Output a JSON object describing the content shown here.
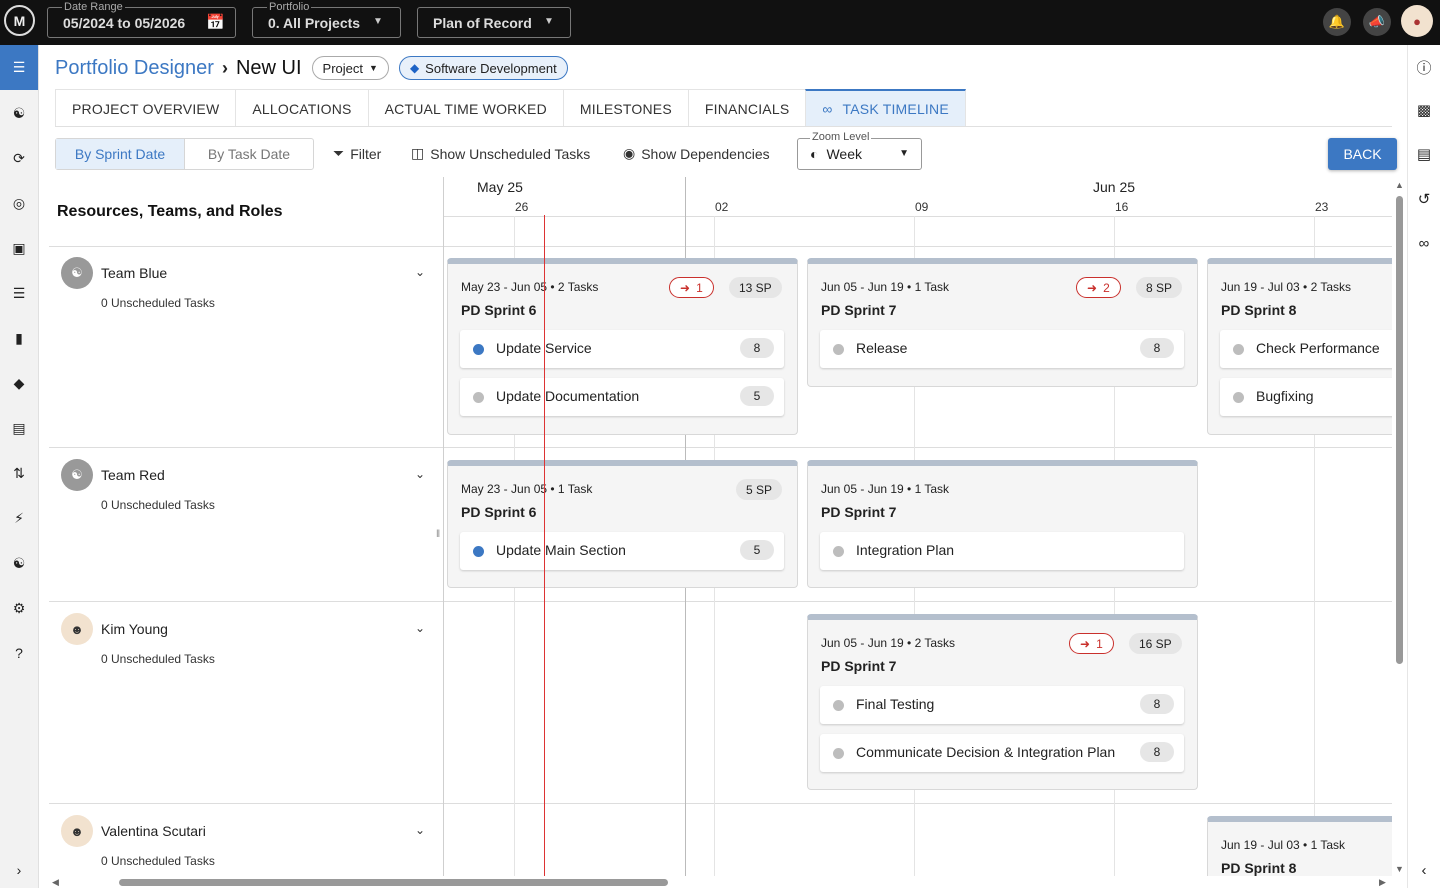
{
  "topbar": {
    "logo": "M",
    "date_range": {
      "label": "Date Range",
      "value": "05/2024 to 05/2026"
    },
    "portfolio": {
      "label": "Portfolio",
      "value": "0. All Projects"
    },
    "plan": {
      "value": "Plan of Record"
    }
  },
  "header": {
    "crumb_link": "Portfolio Designer",
    "crumb_current": "New UI",
    "project_pill": "Project",
    "tag_pill": "Software Development"
  },
  "tabs": [
    "PROJECT OVERVIEW",
    "ALLOCATIONS",
    "ACTUAL TIME WORKED",
    "MILESTONES",
    "FINANCIALS",
    "TASK TIMELINE"
  ],
  "toolbar": {
    "seg_sprint": "By Sprint Date",
    "seg_task": "By Task Date",
    "filter": "Filter",
    "unscheduled": "Show Unscheduled Tasks",
    "dependencies": "Show Dependencies",
    "zoom_label": "Zoom Level",
    "zoom_value": "Week",
    "back": "BACK"
  },
  "grid": {
    "resources_heading": "Resources, Teams, and Roles",
    "months": [
      {
        "label": "May 25"
      },
      {
        "label": "Jun 25"
      }
    ],
    "days": [
      "26",
      "02",
      "09",
      "16",
      "23"
    ]
  },
  "resources": [
    {
      "name": "Team Blue",
      "unscheduled": "0 Unscheduled Tasks",
      "type": "team"
    },
    {
      "name": "Team Red",
      "unscheduled": "0 Unscheduled Tasks",
      "type": "team"
    },
    {
      "name": "Kim Young",
      "unscheduled": "0 Unscheduled Tasks",
      "type": "person"
    },
    {
      "name": "Valentina Scutari",
      "unscheduled": "0 Unscheduled Tasks",
      "type": "person"
    }
  ],
  "cards": [
    {
      "meta": "May 23 - Jun 05 • 2 Tasks",
      "title": "PD Sprint 6",
      "dep": "1",
      "sp": "13 SP",
      "tasks": [
        {
          "name": "Update Service",
          "pts": "8",
          "dot": "blue"
        },
        {
          "name": "Update Documentation",
          "pts": "5",
          "dot": "gray"
        }
      ]
    },
    {
      "meta": "Jun 05 - Jun 19 • 1 Task",
      "title": "PD Sprint 7",
      "dep": "2",
      "sp": "8 SP",
      "tasks": [
        {
          "name": "Release",
          "pts": "8",
          "dot": "gray"
        }
      ]
    },
    {
      "meta": "Jun 19 - Jul 03 • 2 Tasks",
      "title": "PD Sprint 8",
      "tasks": [
        {
          "name": "Check Performance",
          "dot": "gray"
        },
        {
          "name": "Bugfixing",
          "dot": "gray"
        }
      ]
    },
    {
      "meta": "May 23 - Jun 05 • 1 Task",
      "title": "PD Sprint 6",
      "sp": "5 SP",
      "tasks": [
        {
          "name": "Update Main Section",
          "pts": "5",
          "dot": "blue"
        }
      ]
    },
    {
      "meta": "Jun 05 - Jun 19 • 1 Task",
      "title": "PD Sprint 7",
      "tasks": [
        {
          "name": "Integration Plan",
          "dot": "gray"
        }
      ]
    },
    {
      "meta": "Jun 05 - Jun 19 • 2 Tasks",
      "title": "PD Sprint 7",
      "dep": "1",
      "sp": "16 SP",
      "tasks": [
        {
          "name": "Final Testing",
          "pts": "8",
          "dot": "gray"
        },
        {
          "name": "Communicate Decision & Integration Plan",
          "pts": "8",
          "dot": "gray"
        }
      ]
    },
    {
      "meta": "Jun 19 - Jul 03 • 1 Task",
      "title": "PD Sprint 8",
      "tasks": []
    }
  ],
  "colors": {
    "accent": "#3c78c3",
    "dependency": "#c9302c",
    "today_line": "#dd3333"
  }
}
